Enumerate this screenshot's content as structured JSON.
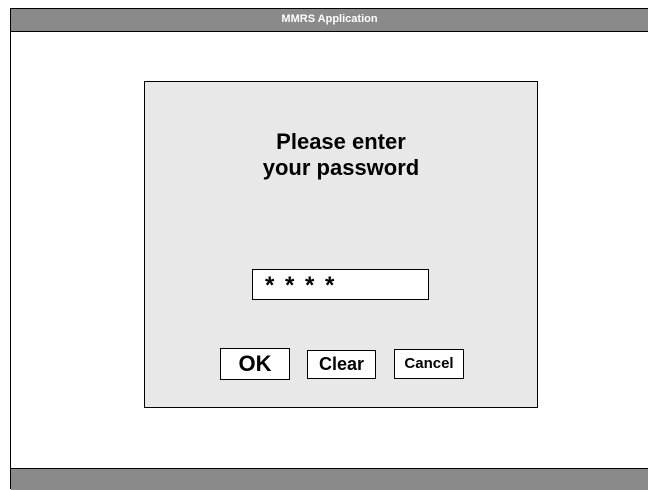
{
  "window": {
    "title": "MMRS Application"
  },
  "dialog": {
    "prompt_line1": "Please enter",
    "prompt_line2": "your password",
    "password_value": "* * * *",
    "ok_label": "OK",
    "clear_label": "Clear",
    "cancel_label": "Cancel"
  }
}
